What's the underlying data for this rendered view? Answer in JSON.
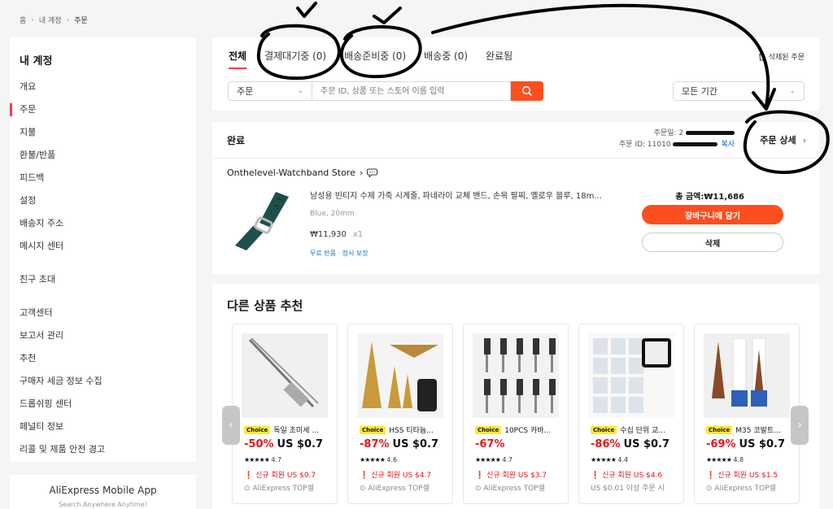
{
  "breadcrumb": {
    "home": "홈",
    "account": "내 계정",
    "current": "주문"
  },
  "sidebar": {
    "title": "내 계정",
    "items": [
      "개요",
      "주문",
      "지불",
      "환불/반품",
      "피드백",
      "설정",
      "배송지 주소",
      "메시지 센터"
    ],
    "invite": "친구 초대",
    "items2": [
      "고객센터",
      "보고서 관리",
      "추천",
      "구매자 세금 정보 수집",
      "드롭쉬핑 센터",
      "페널티 정보",
      "리콜 및 제품 안전 경고"
    ]
  },
  "mobile_app": {
    "title": "AliExpress Mobile App",
    "subtitle": "Search Anywhere Anytime!"
  },
  "tabs": [
    {
      "label": "전체"
    },
    {
      "label": "결제대기중 (0)"
    },
    {
      "label": "배송준비중 (0)"
    },
    {
      "label": "배송중 (0)"
    },
    {
      "label": "완료됨"
    }
  ],
  "deleted_orders": "삭제된 주문",
  "filter": {
    "type": "주문",
    "search_placeholder": "주문 ID, 상품 또는 스토어 이름 입력",
    "period": "모든 기간"
  },
  "order": {
    "status": "완료",
    "date_label": "주문일: 2",
    "id_label": "주문 ID: 11010",
    "copy": "복사",
    "detail": "주문 상세",
    "store": "Onthelevel-Watchband Store",
    "product_name": "남성용 빈티지 수제 가죽 시계줄, 파네라이 교체 밴드, 손목 팔찌, 옐로우 블루, 18m...",
    "variant": "Blue, 20mm",
    "price": "₩11,930",
    "qty": "x1",
    "badge": "무료 반품 · 정시 보장",
    "total": "총 금액:₩11,686",
    "add_cart": "장바구니에 담기",
    "delete": "삭제"
  },
  "recommend": {
    "title": "다른 상품 추천",
    "choice_label": "Choice",
    "top_label": "AliExpress TOP셀",
    "cards": [
      {
        "name": "독일 초미세 ...",
        "discount": "-50%",
        "price": "US $0.7",
        "stars": "★★★★★",
        "rating": "4.7",
        "promo": "신규 회원 US $0.7",
        "top": "AliExpress TOP셀",
        "image": "tweezers"
      },
      {
        "name": "HSS 티타늄...",
        "discount": "-87%",
        "price": "US $0.7",
        "stars": "★★★★★",
        "rating": "4.6",
        "promo": "신규 회원 US $4.7",
        "top": "AliExpress TOP셀",
        "image": "step-drill"
      },
      {
        "name": "10PCS 카바...",
        "discount": "-67%",
        "price": "",
        "stars": "★★★★★",
        "rating": "4.7",
        "promo": "신규 회원 US $3.7",
        "top": "AliExpress TOP셀",
        "image": "burr-set"
      },
      {
        "name": "수십 단위 교...",
        "discount": "-86%",
        "price": "US $0.7",
        "stars": "★★★★★",
        "rating": "4.4",
        "promo": "신규 회원 US $4.6",
        "top": "US $0.01 이상 주문 시",
        "image": "pads"
      },
      {
        "name": "M35 코발트...",
        "discount": "-69%",
        "price": "US $0.7",
        "stars": "★★★★★",
        "rating": "4.8",
        "promo": "신규 회원 US $1.5",
        "top": "AliExpress TOP셀",
        "image": "cobalt-drill"
      }
    ]
  },
  "colors": {
    "accent": "#fd4f1e",
    "tab_underline": "#fd384f",
    "discount": "#e4151c",
    "choice": "#fde830",
    "link": "#0066cc"
  }
}
